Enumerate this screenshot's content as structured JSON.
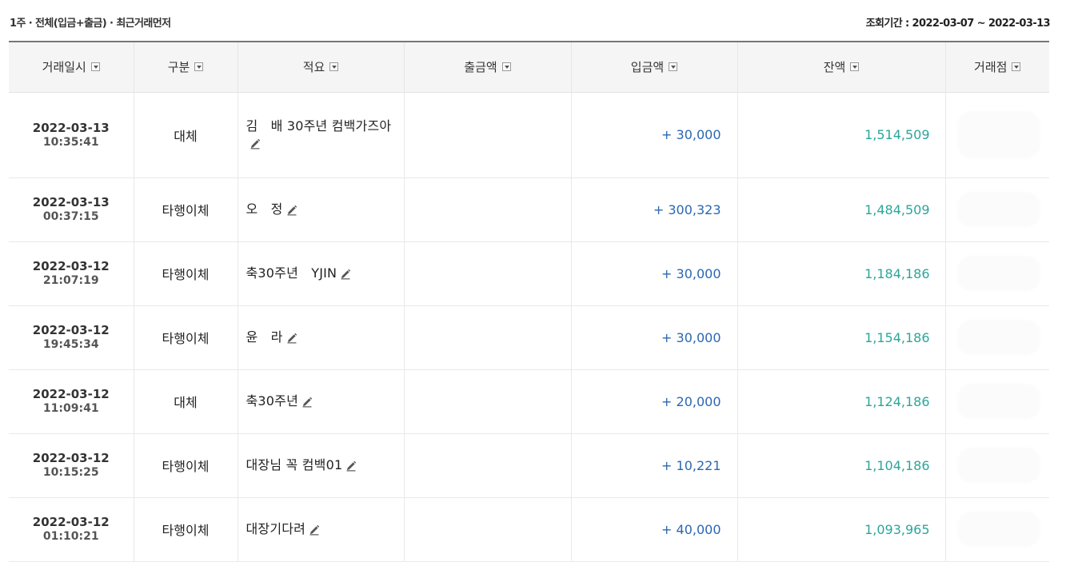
{
  "header": {
    "filter_summary": "1주 · 전체(입금+출금) · 최근거래먼저",
    "period_label": "조회기간 : 2022-03-07 ~ 2022-03-13"
  },
  "columns": {
    "date": "거래일시",
    "category": "구분",
    "memo": "적요",
    "withdraw": "출금액",
    "deposit": "입금액",
    "balance": "잔액",
    "branch": "거래점"
  },
  "icons": {
    "sort": "dropdown-arrow-icon",
    "edit": "pencil-icon"
  },
  "colors": {
    "deposit": "#2a67b1",
    "balance": "#2aa69a",
    "header_bg": "#f5f5f5"
  },
  "rows": [
    {
      "date": "2022-03-13",
      "time": "10:35:41",
      "category": "대체",
      "memo": "김　배 30주년 컴백가즈아",
      "withdraw": "",
      "deposit": "+ 30,000",
      "balance": "1,514,509"
    },
    {
      "date": "2022-03-13",
      "time": "00:37:15",
      "category": "타행이체",
      "memo": "오　정",
      "withdraw": "",
      "deposit": "+ 300,323",
      "balance": "1,484,509"
    },
    {
      "date": "2022-03-12",
      "time": "21:07:19",
      "category": "타행이체",
      "memo": "축30주년　YJIN",
      "withdraw": "",
      "deposit": "+ 30,000",
      "balance": "1,184,186"
    },
    {
      "date": "2022-03-12",
      "time": "19:45:34",
      "category": "타행이체",
      "memo": "윤　라",
      "withdraw": "",
      "deposit": "+ 30,000",
      "balance": "1,154,186"
    },
    {
      "date": "2022-03-12",
      "time": "11:09:41",
      "category": "대체",
      "memo": "축30주년",
      "withdraw": "",
      "deposit": "+ 20,000",
      "balance": "1,124,186"
    },
    {
      "date": "2022-03-12",
      "time": "10:15:25",
      "category": "타행이체",
      "memo": "대장님 꼭 컴백01",
      "withdraw": "",
      "deposit": "+ 10,221",
      "balance": "1,104,186"
    },
    {
      "date": "2022-03-12",
      "time": "01:10:21",
      "category": "타행이체",
      "memo": "대장기다려",
      "withdraw": "",
      "deposit": "+ 40,000",
      "balance": "1,093,965"
    }
  ]
}
